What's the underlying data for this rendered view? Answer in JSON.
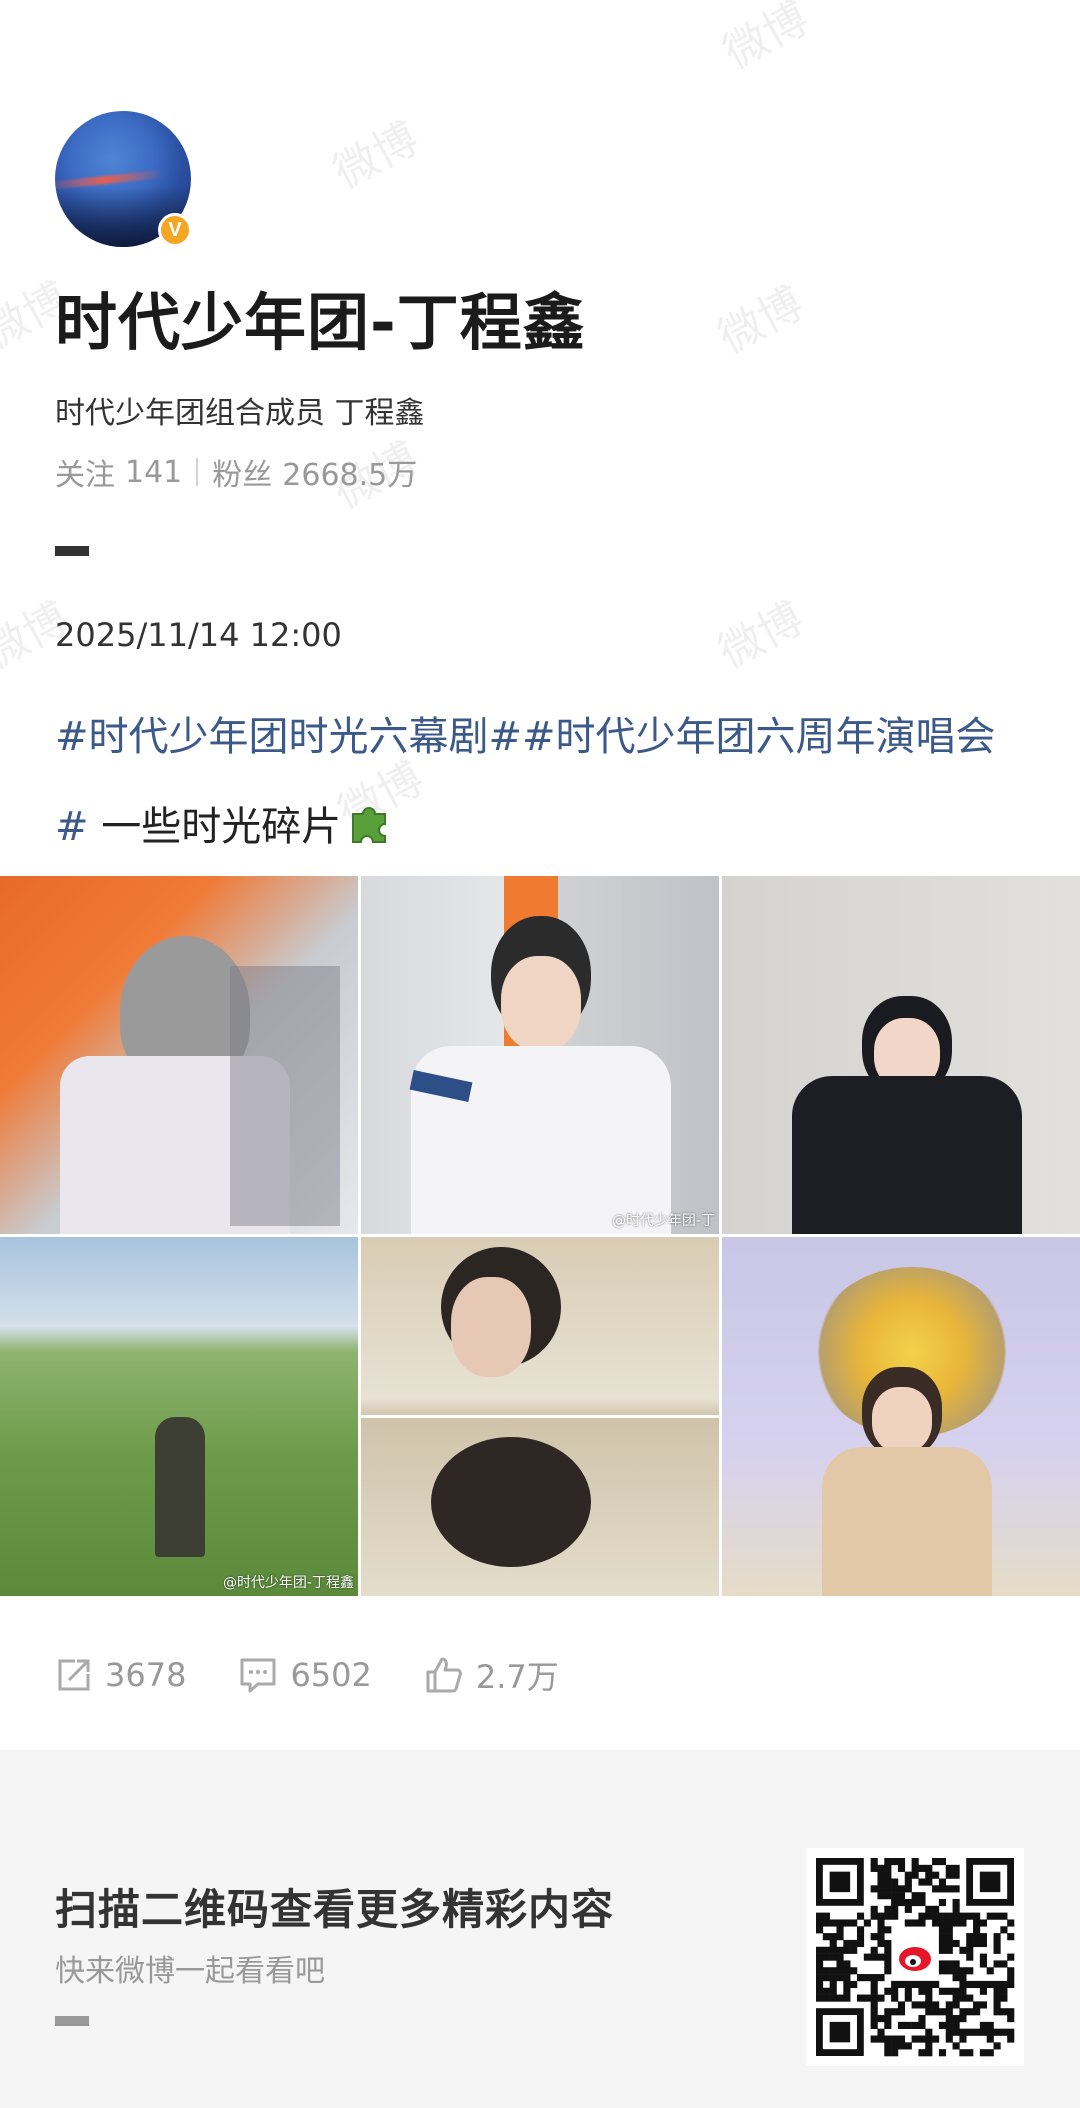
{
  "profile": {
    "name": "时代少年团-丁程鑫",
    "verified_label": "V",
    "description": "时代少年团组合成员 丁程鑫",
    "following_label": "关注",
    "following_count": "141",
    "followers_label": "粉丝",
    "followers_count": "2668.5万"
  },
  "post": {
    "date": "2025/11/14 12:00",
    "tag1": "#时代少年团时光六幕剧#",
    "tag2": "#时代少年团六周年演唱会#",
    "text": " 一些时光碎片",
    "emoji_icon": "puzzle-icon",
    "images": [
      {
        "caption": ""
      },
      {
        "caption": "@时代少年团-丁"
      },
      {
        "caption": ""
      },
      {
        "caption": "@时代少年团-丁程鑫"
      },
      {
        "caption": ""
      },
      {
        "caption": ""
      }
    ]
  },
  "actions": {
    "repost": "3678",
    "comment": "6502",
    "like": "2.7万"
  },
  "footer": {
    "title": "扫描二维码查看更多精彩内容",
    "subtitle": "快来微博一起看看吧"
  },
  "watermark_text": "微博",
  "colors": {
    "tag": "#3b5a8a",
    "badge": "#f5a623",
    "muted": "#999999",
    "footer_bg": "#f5f5f5"
  }
}
